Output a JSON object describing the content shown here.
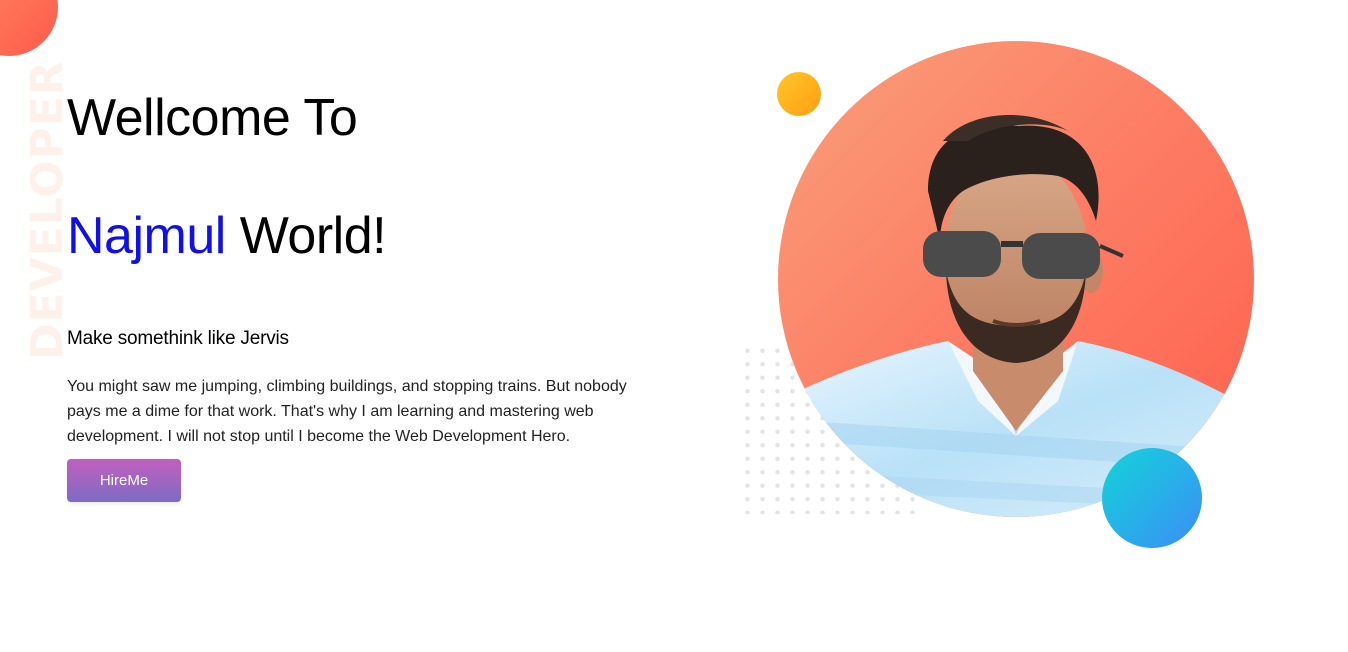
{
  "side_watermark": "DEVELOPER",
  "hero": {
    "title_line1": "Wellcome To",
    "title_name": "Najmul",
    "title_rest": " World!",
    "subtitle": "Make somethink like Jervis",
    "bio": "You might saw me jumping, climbing buildings, and stopping trains. But nobody pays me a dime for that work. That's why I am learning and mastering web development. I will not stop until I become the Web Development Hero.",
    "cta_label": "HireMe"
  },
  "colors": {
    "accent_name": "#1010e8",
    "circle_main": "#fd7c63",
    "dot_yellow": "#ffc629",
    "blob_blue": "#3b8df7",
    "button_gradient_top": "#c25fbf",
    "button_gradient_bottom": "#7c6cc4"
  },
  "icons": {
    "portrait": "person-portrait-illustration"
  }
}
